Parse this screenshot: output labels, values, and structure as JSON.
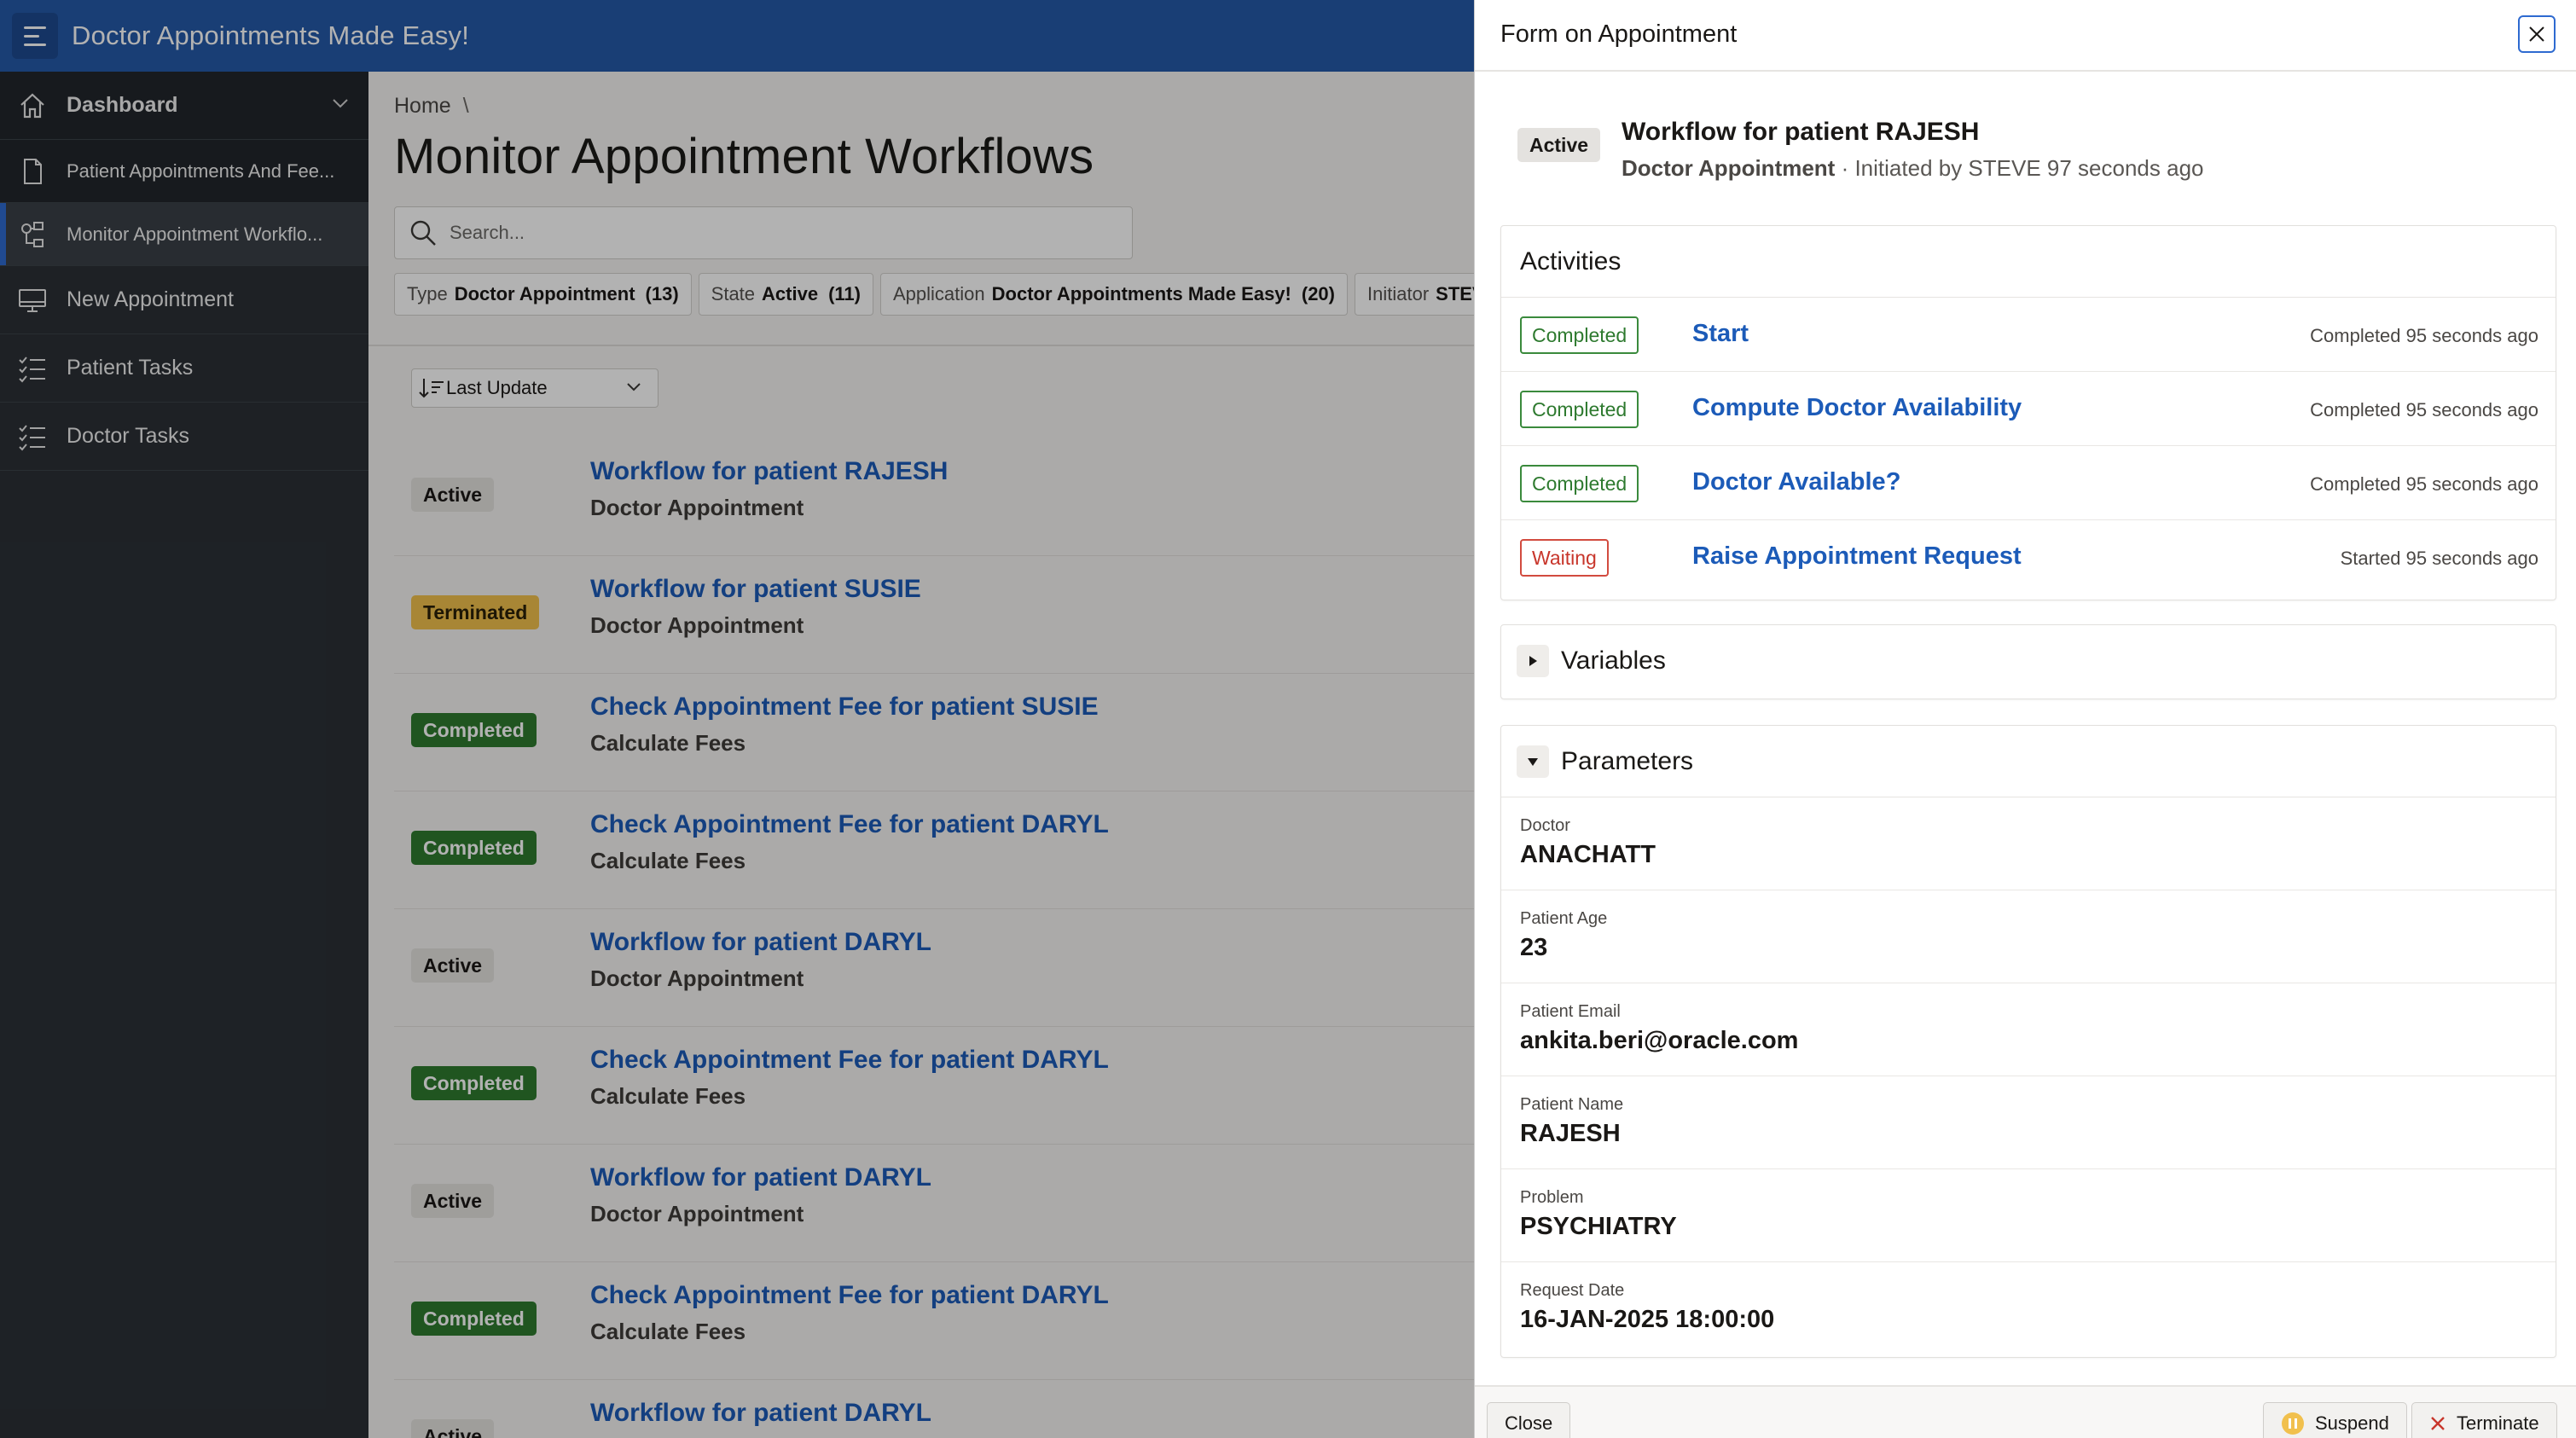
{
  "header": {
    "app_title": "Doctor Appointments Made Easy!"
  },
  "sidebar": {
    "items": [
      {
        "label": "Dashboard",
        "icon": "home-icon"
      },
      {
        "label": "Patient Appointments And Fee...",
        "icon": "document-icon"
      },
      {
        "label": "Monitor Appointment Workflo...",
        "icon": "workflow-icon"
      },
      {
        "label": "New Appointment",
        "icon": "monitor-icon"
      },
      {
        "label": "Patient Tasks",
        "icon": "checklist-icon"
      },
      {
        "label": "Doctor Tasks",
        "icon": "checklist-icon"
      }
    ]
  },
  "main": {
    "breadcrumb": {
      "home": "Home",
      "separator": "\\"
    },
    "title": "Monitor Appointment Workflows",
    "search": {
      "placeholder": "Search..."
    },
    "facets": [
      {
        "key": "Type",
        "value": "Doctor Appointment",
        "count": "(13)"
      },
      {
        "key": "State",
        "value": "Active",
        "count": "(11)"
      },
      {
        "key": "Application",
        "value": "Doctor Appointments Made Easy!",
        "count": "(20)"
      },
      {
        "key": "Initiator",
        "value": "STEVE",
        "count": ""
      }
    ],
    "sort": {
      "label": "Last Update"
    },
    "workflows": [
      {
        "status": "Active",
        "title": "Workflow for patient RAJESH",
        "subtitle": "Doctor Appointment"
      },
      {
        "status": "Terminated",
        "title": "Workflow for patient SUSIE",
        "subtitle": "Doctor Appointment"
      },
      {
        "status": "Completed",
        "title": "Check Appointment Fee for patient SUSIE",
        "subtitle": "Calculate Fees"
      },
      {
        "status": "Completed",
        "title": "Check Appointment Fee for patient DARYL",
        "subtitle": "Calculate Fees"
      },
      {
        "status": "Active",
        "title": "Workflow for patient DARYL",
        "subtitle": "Doctor Appointment"
      },
      {
        "status": "Completed",
        "title": "Check Appointment Fee for patient DARYL",
        "subtitle": "Calculate Fees"
      },
      {
        "status": "Active",
        "title": "Workflow for patient DARYL",
        "subtitle": "Doctor Appointment"
      },
      {
        "status": "Completed",
        "title": "Check Appointment Fee for patient DARYL",
        "subtitle": "Calculate Fees"
      },
      {
        "status": "Active",
        "title": "Workflow for patient DARYL",
        "subtitle": ""
      }
    ]
  },
  "drawer": {
    "title": "Form on Appointment",
    "summary": {
      "status": "Active",
      "title": "Workflow for patient RAJESH",
      "type": "Doctor Appointment",
      "initiated": "· Initiated by STEVE 97 seconds ago"
    },
    "activities": {
      "heading": "Activities",
      "rows": [
        {
          "status": "Completed",
          "name": "Start",
          "time": "Completed 95 seconds ago"
        },
        {
          "status": "Completed",
          "name": "Compute Doctor Availability",
          "time": "Completed 95 seconds ago"
        },
        {
          "status": "Completed",
          "name": "Doctor Available?",
          "time": "Completed 95 seconds ago"
        },
        {
          "status": "Waiting",
          "name": "Raise Appointment Request",
          "time": "Started 95 seconds ago"
        }
      ]
    },
    "variables": {
      "heading": "Variables"
    },
    "parameters": {
      "heading": "Parameters",
      "rows": [
        {
          "label": "Doctor",
          "value": "ANACHATT"
        },
        {
          "label": "Patient Age",
          "value": "23"
        },
        {
          "label": "Patient Email",
          "value": "ankita.beri@oracle.com"
        },
        {
          "label": "Patient Name",
          "value": "RAJESH"
        },
        {
          "label": "Problem",
          "value": "PSYCHIATRY"
        },
        {
          "label": "Request Date",
          "value": "16-JAN-2025 18:00:00"
        }
      ]
    },
    "footer": {
      "close": "Close",
      "suspend": "Suspend",
      "terminate": "Terminate"
    }
  },
  "colors": {
    "header": "#2559a8",
    "sidebar": "#2b3036",
    "link": "#1c5bb8",
    "completed": "#2e7a2f",
    "terminated": "#f1c04d",
    "waiting": "#c8362b"
  }
}
